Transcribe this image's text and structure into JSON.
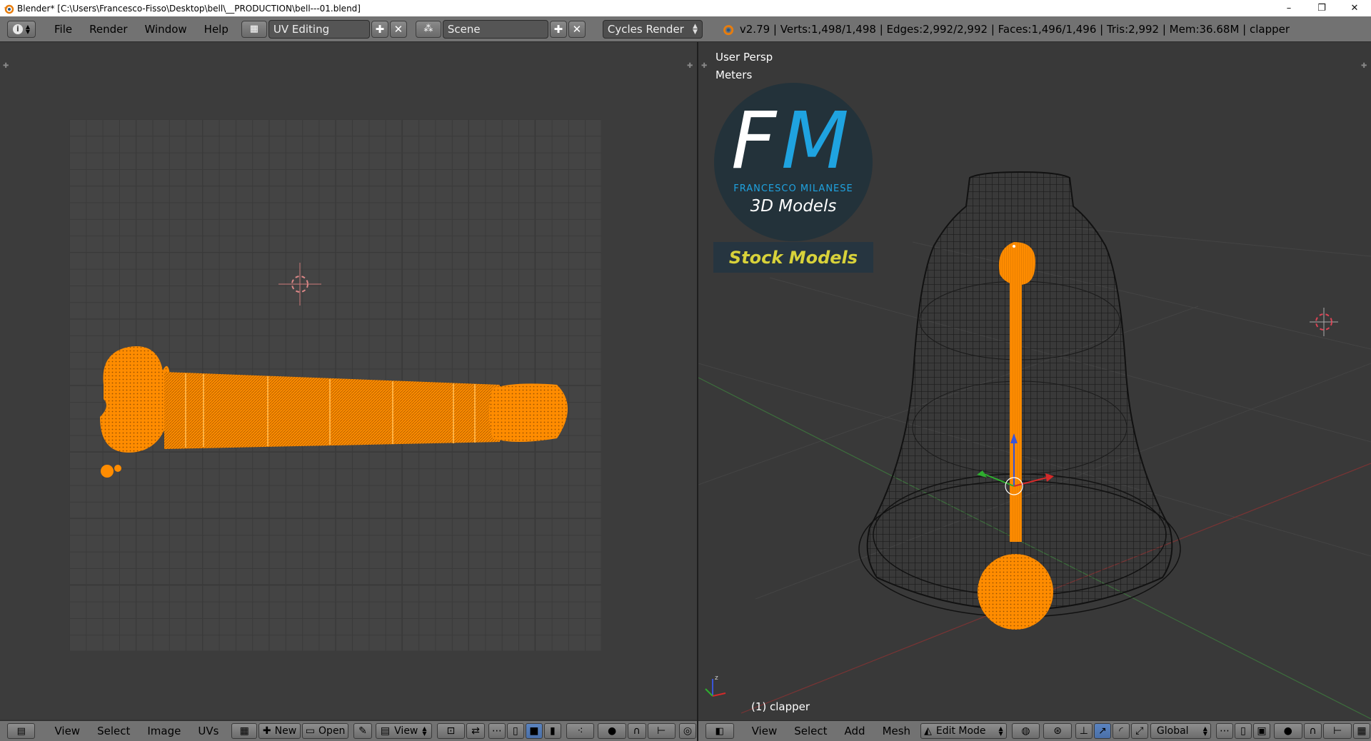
{
  "window": {
    "title": "Blender* [C:\\Users\\Francesco-Fisso\\Desktop\\bell\\__PRODUCTION\\bell---01.blend]",
    "controls": [
      "–",
      "❐",
      "✕"
    ]
  },
  "info_header": {
    "menus": [
      "File",
      "Render",
      "Window",
      "Help"
    ],
    "screen_layout": "UV Editing",
    "scene": "Scene",
    "render_engine": "Cycles Render",
    "stats": "v2.79 | Verts:1,498/1,498 | Edges:2,992/2,992 | Faces:1,496/1,496 | Tris:2,992 | Mem:36.68M | clapper"
  },
  "uv_editor": {
    "menus": [
      "View",
      "Select",
      "Image",
      "UVs"
    ],
    "new_label": "New",
    "open_label": "Open",
    "view_label": "View"
  },
  "viewport": {
    "view_name": "User Persp",
    "units": "Meters",
    "object_label": "(1) clapper",
    "menus": [
      "View",
      "Select",
      "Add",
      "Mesh"
    ],
    "mode": "Edit Mode",
    "orientation": "Global"
  },
  "watermark": {
    "logo_letters_f": "F",
    "logo_letters_m": "M",
    "brand": "FRANCESCO MILANESE",
    "subtitle": "3D Models",
    "tag": "Stock Models"
  },
  "colors": {
    "accent_orange": "#ff8c00",
    "panel_bg": "#393939",
    "header_bg": "#727272",
    "logo_blue": "#1fa3e0",
    "tag_yellow": "#d8d23a"
  }
}
